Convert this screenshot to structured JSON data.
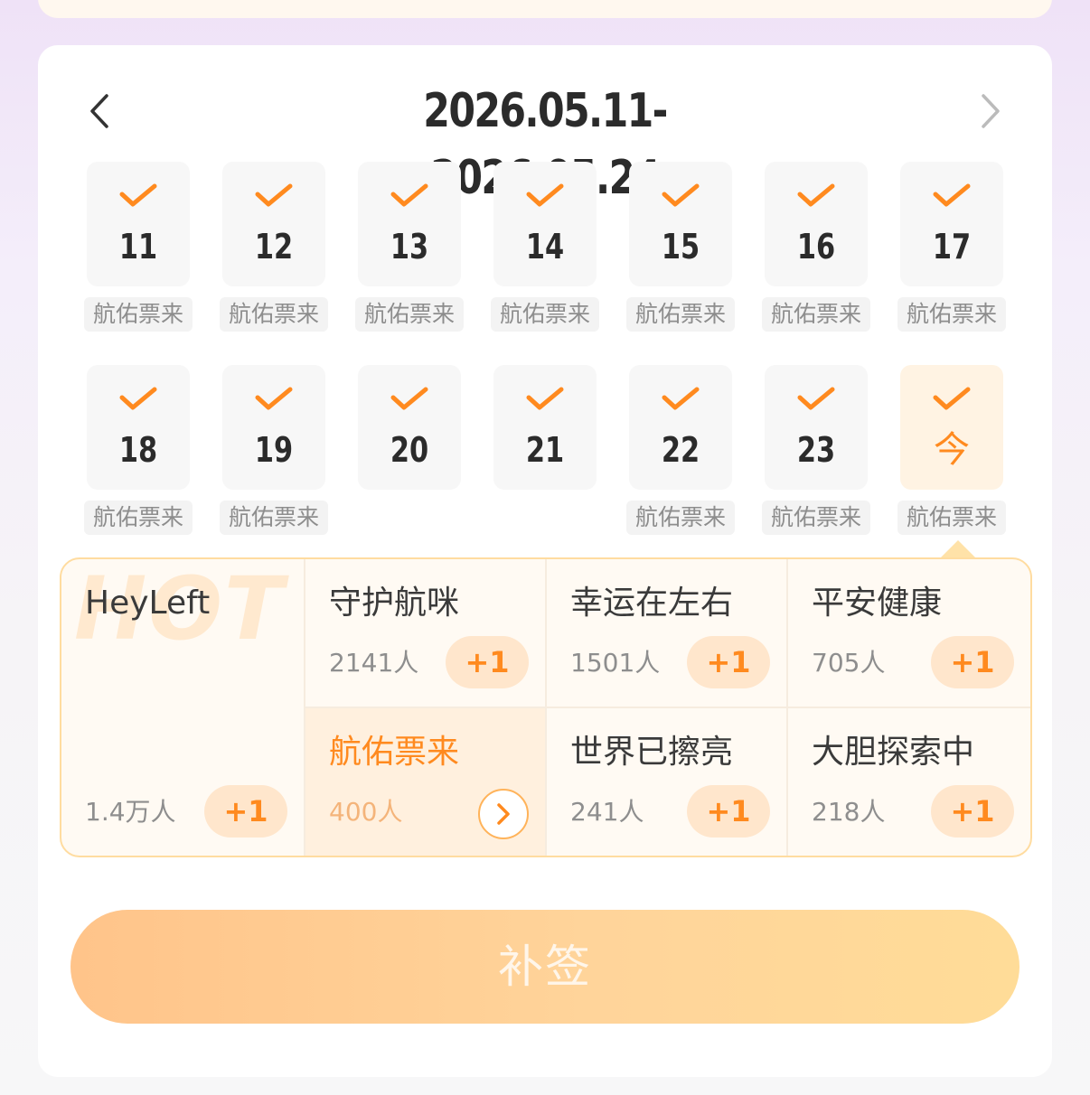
{
  "date_range": "2026.05.11-2026.05.24",
  "colors": {
    "accent": "#ff8a1f",
    "check": "#ff8a1f",
    "border": "#ffdca0"
  },
  "week1": [
    {
      "num": "11",
      "tag": "航佑票来"
    },
    {
      "num": "12",
      "tag": "航佑票来"
    },
    {
      "num": "13",
      "tag": "航佑票来"
    },
    {
      "num": "14",
      "tag": "航佑票来"
    },
    {
      "num": "15",
      "tag": "航佑票来"
    },
    {
      "num": "16",
      "tag": "航佑票来"
    },
    {
      "num": "17",
      "tag": "航佑票来"
    }
  ],
  "week2": [
    {
      "num": "18",
      "tag": "航佑票来"
    },
    {
      "num": "19",
      "tag": "航佑票来"
    },
    {
      "num": "20",
      "tag": ""
    },
    {
      "num": "21",
      "tag": ""
    },
    {
      "num": "22",
      "tag": "航佑票来"
    },
    {
      "num": "23",
      "tag": "航佑票来"
    },
    {
      "num": "今",
      "tag": "航佑票来"
    }
  ],
  "hot_label": "HOT",
  "cards": {
    "heyleft": {
      "title": "HeyLeft",
      "count": "1.4万人",
      "plus": "+1"
    },
    "c1": {
      "title": "守护航咪",
      "count": "2141人",
      "plus": "+1"
    },
    "c2": {
      "title": "幸运在左右",
      "count": "1501人",
      "plus": "+1"
    },
    "c3": {
      "title": "平安健康",
      "count": "705人",
      "plus": "+1"
    },
    "c4": {
      "title": "航佑票来",
      "count": "400人"
    },
    "c5": {
      "title": "世界已擦亮",
      "count": "241人",
      "plus": "+1"
    },
    "c6": {
      "title": "大胆探索中",
      "count": "218人",
      "plus": "+1"
    }
  },
  "main_button": "补签"
}
